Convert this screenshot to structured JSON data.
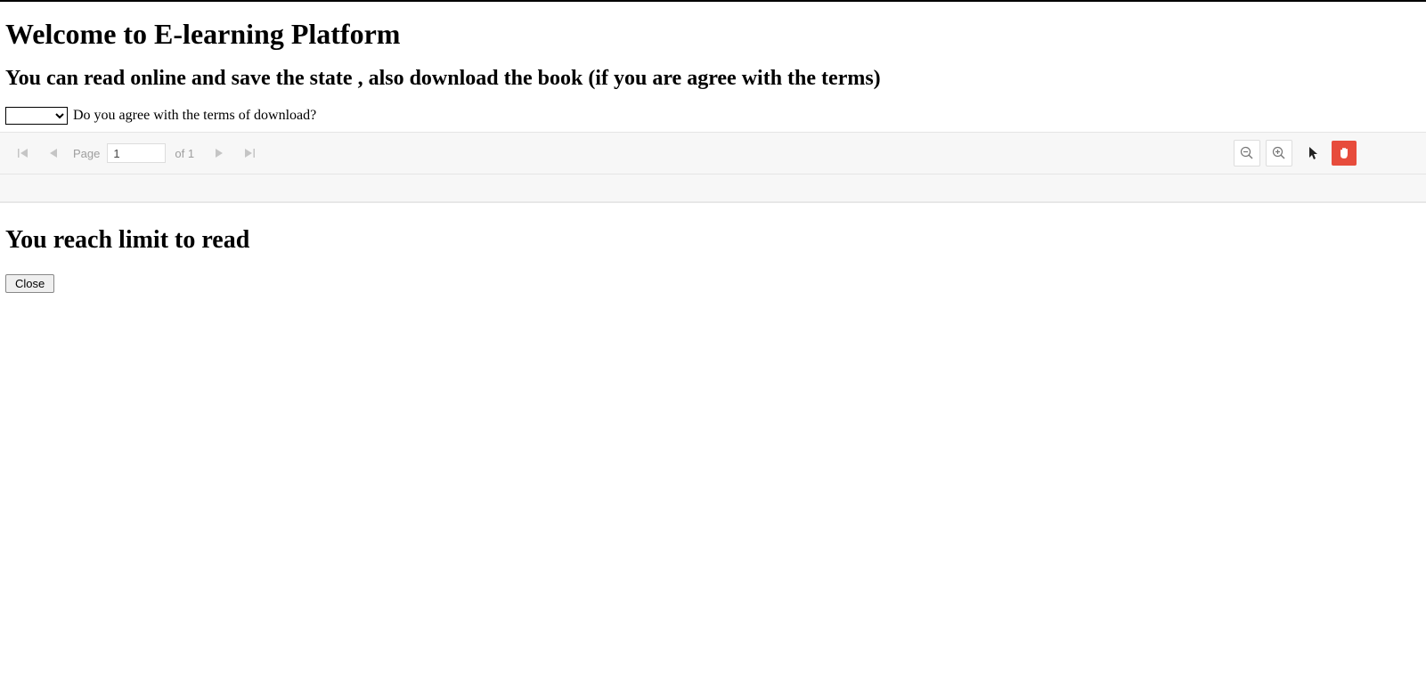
{
  "header": {
    "title": "Welcome to E-learning Platform",
    "subtitle": "You can read online and save the state , also download the book (if you are agree with the terms)"
  },
  "terms": {
    "select_value": "",
    "question": "Do you agree with the terms of download?"
  },
  "viewer": {
    "page_label": "Page",
    "page_value": "1",
    "of_label": "of 1"
  },
  "limit": {
    "heading": "You reach limit to read",
    "close_label": "Close"
  },
  "colors": {
    "accent": "#e74c3c"
  }
}
